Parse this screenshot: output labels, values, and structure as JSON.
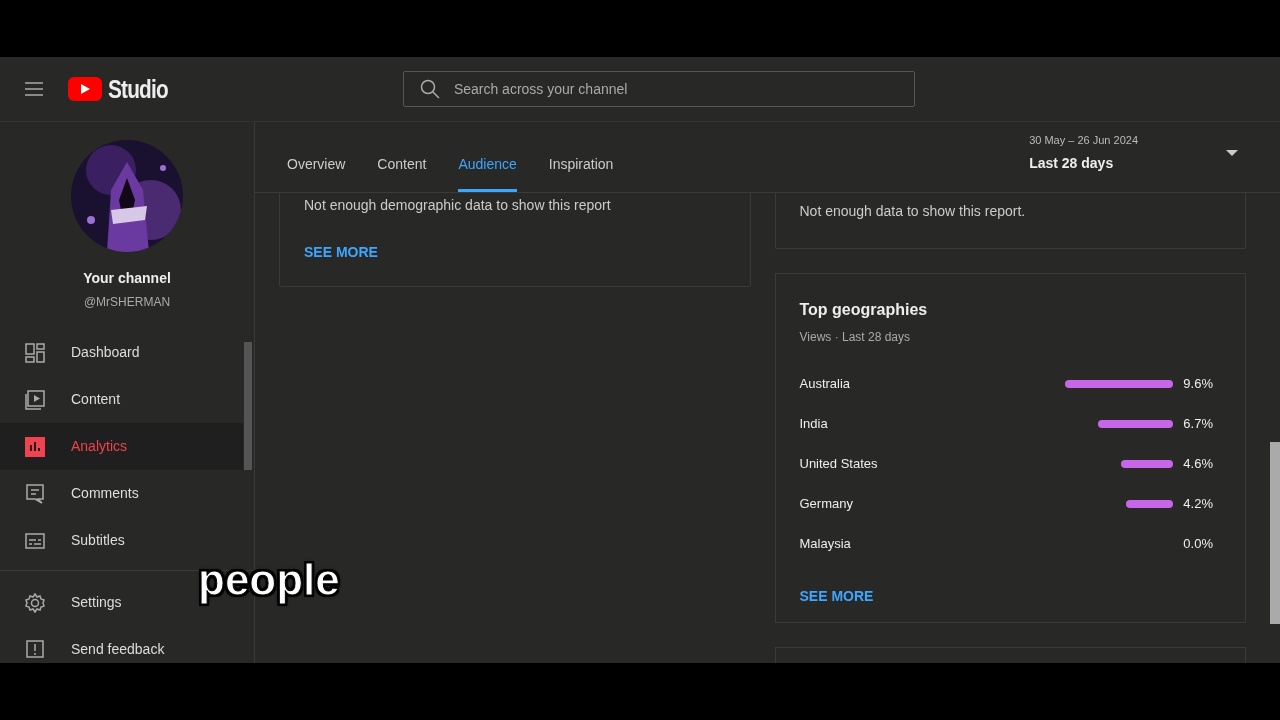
{
  "header": {
    "logo_text": "Studio",
    "search": {
      "placeholder": "Search across your channel"
    }
  },
  "channel": {
    "title": "Your channel",
    "handle": "@MrSHERMAN"
  },
  "sidebar": {
    "items": [
      {
        "label": "Dashboard",
        "selected": false
      },
      {
        "label": "Content",
        "selected": false
      },
      {
        "label": "Analytics",
        "selected": true
      },
      {
        "label": "Comments",
        "selected": false
      },
      {
        "label": "Subtitles",
        "selected": false
      }
    ],
    "bottom_items": [
      {
        "label": "Settings"
      },
      {
        "label": "Send feedback"
      }
    ]
  },
  "tabs": [
    {
      "label": "Overview",
      "selected": false
    },
    {
      "label": "Content",
      "selected": false
    },
    {
      "label": "Audience",
      "selected": true
    },
    {
      "label": "Inspiration",
      "selected": false
    }
  ],
  "date_range": {
    "dates": "30 May – 26 Jun 2024",
    "label": "Last 28 days"
  },
  "demographics_card": {
    "message": "Not enough demographic data to show this report",
    "link": "SEE MORE"
  },
  "report_card": {
    "message": "Not enough data to show this report."
  },
  "geographies": {
    "title": "Top geographies",
    "subtitle": "Views · Last 28 days",
    "rows": [
      {
        "country": "Australia",
        "value": "9.6%"
      },
      {
        "country": "India",
        "value": "6.7%"
      },
      {
        "country": "United States",
        "value": "4.6%"
      },
      {
        "country": "Germany",
        "value": "4.2%"
      },
      {
        "country": "Malaysia",
        "value": "0.0%"
      }
    ],
    "link": "SEE MORE"
  },
  "caption": "people"
}
